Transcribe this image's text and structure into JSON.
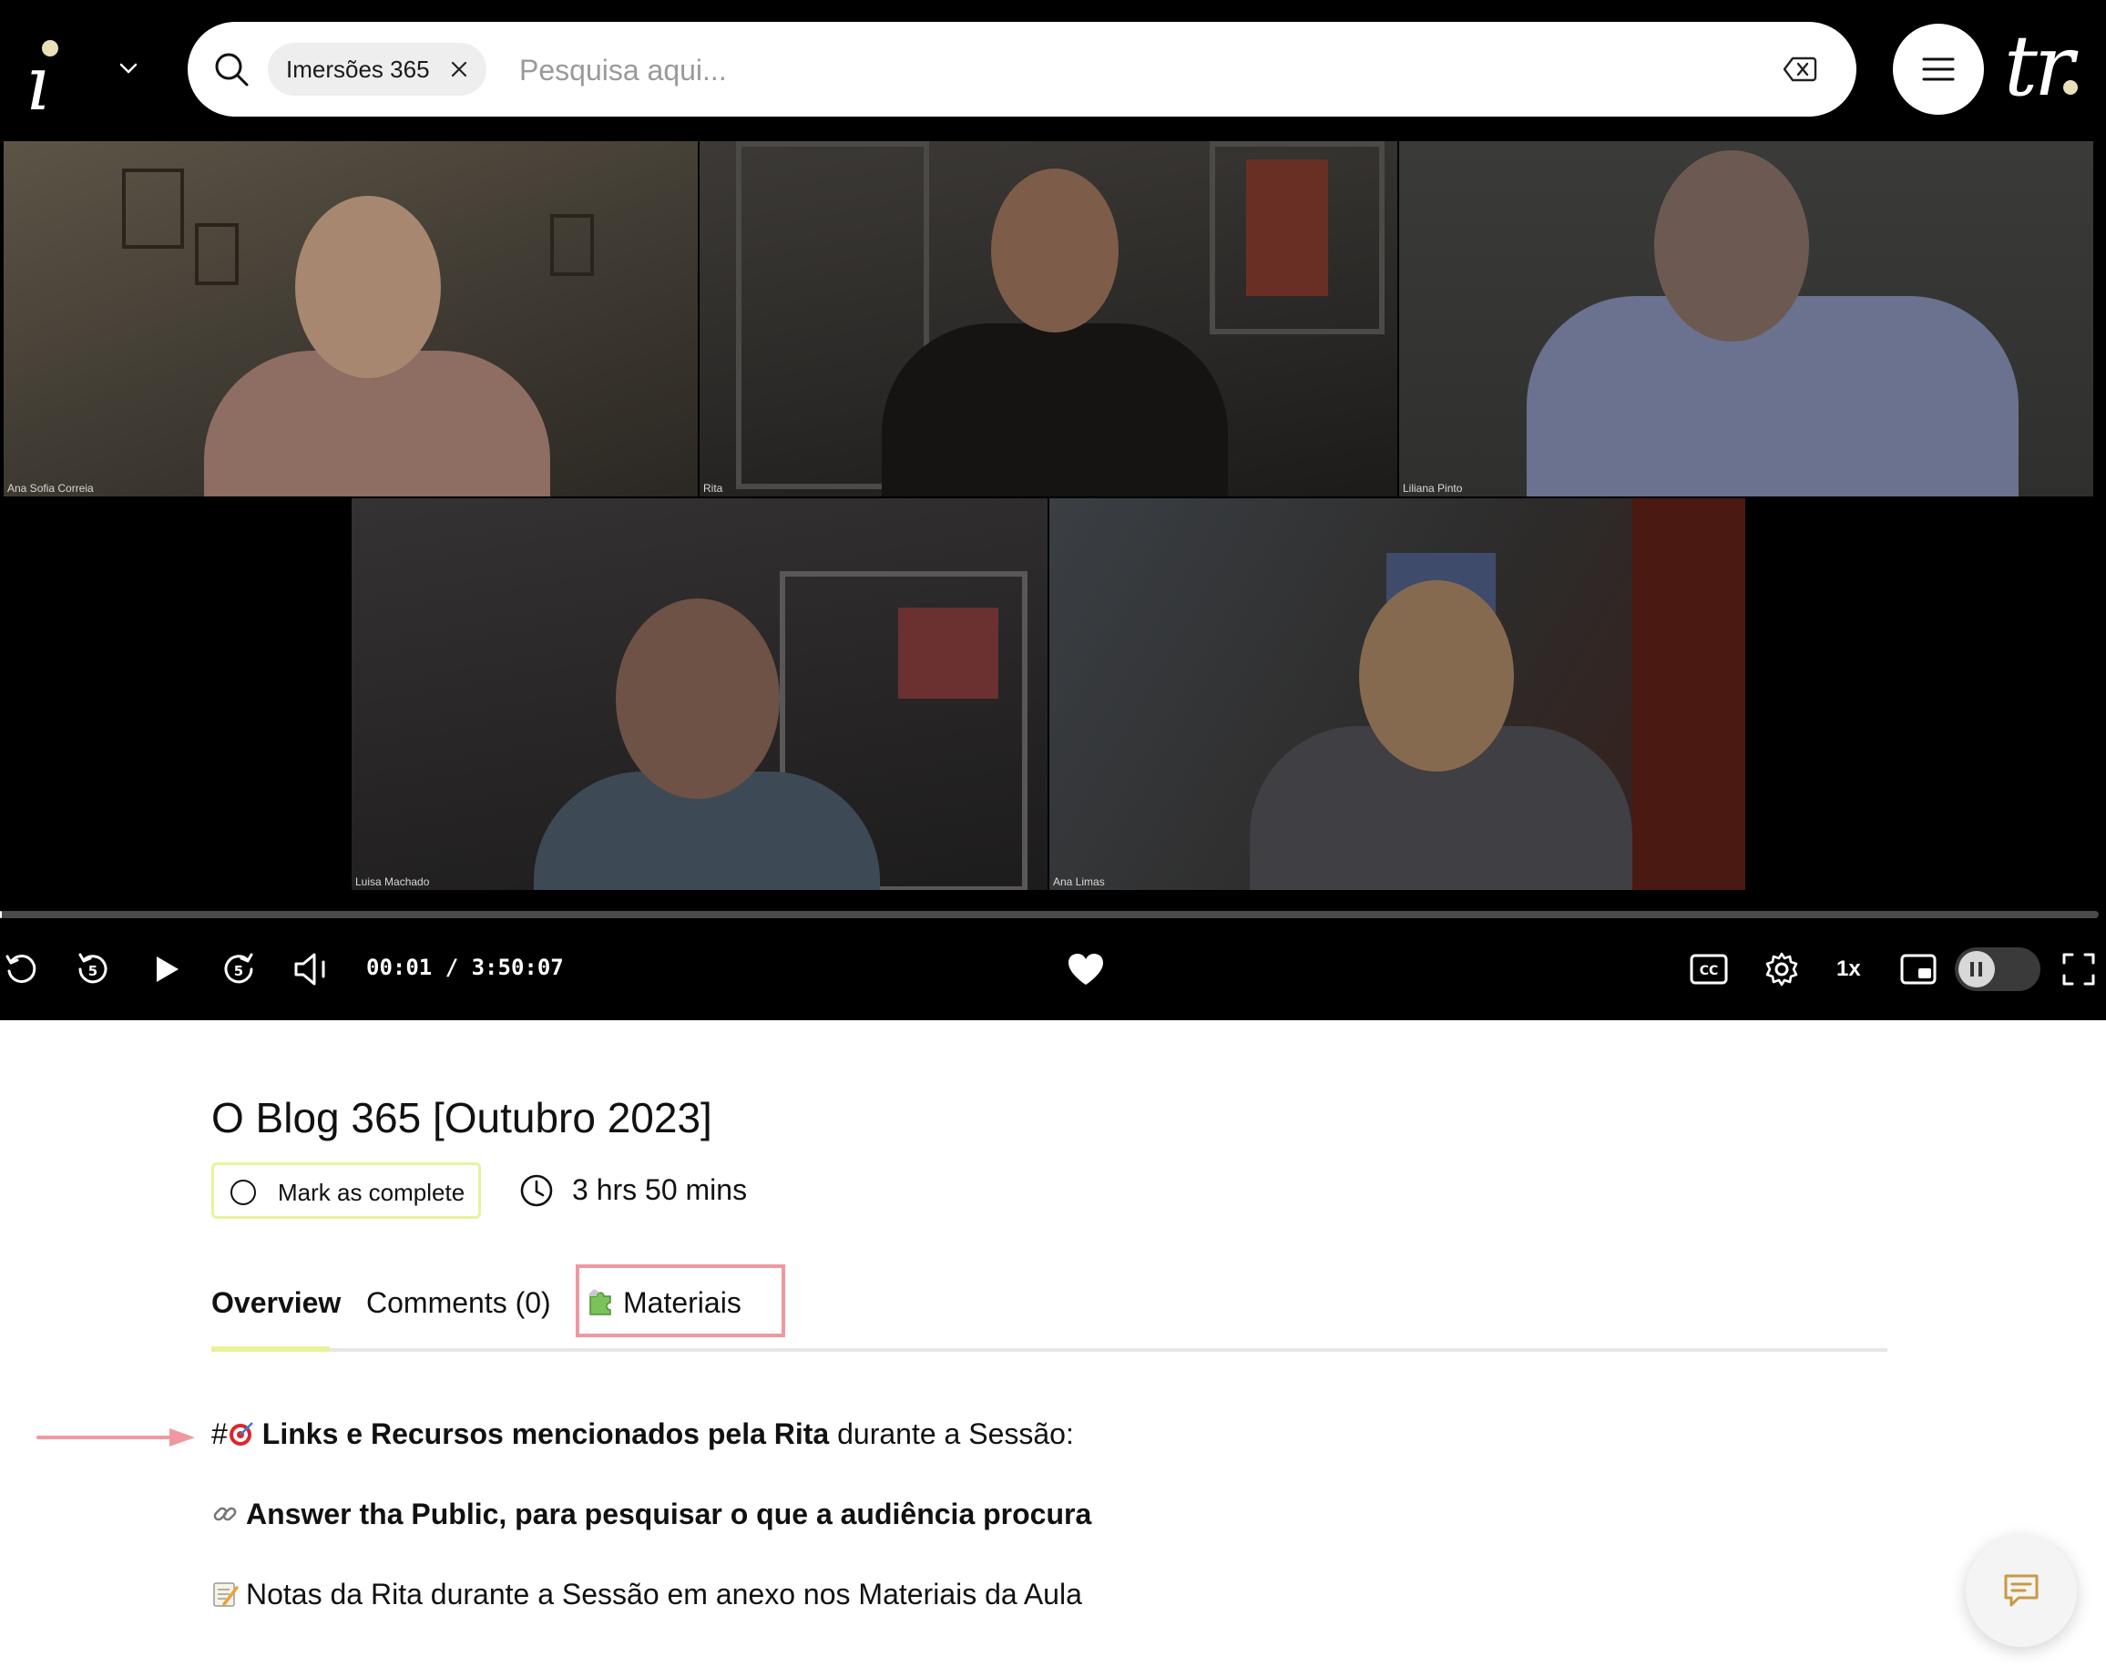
{
  "header": {
    "search_chip": "Imersões 365",
    "search_placeholder": "Pesquisa aqui..."
  },
  "video": {
    "participants": [
      "Ana Sofia Correia",
      "Rita",
      "Liliana Pinto",
      "Luisa Machado",
      "Ana Limas"
    ],
    "time": "00:01 / 3:50:07",
    "progress": 0.0001,
    "speed": "1x"
  },
  "lesson": {
    "title": "O Blog 365 [Outubro 2023]",
    "mark_complete": "Mark as complete",
    "duration": "3 hrs 50 mins"
  },
  "tabs": [
    {
      "label": "Overview",
      "active": true
    },
    {
      "label": "Comments (0)",
      "active": false
    },
    {
      "label": "Materiais",
      "active": false,
      "icon": "puzzle-icon"
    }
  ],
  "content": {
    "line1": {
      "prefix": "#",
      "bold": "Links e Recursos mencionados pela Rita",
      "rest": " durante a Sessão:"
    },
    "line2": {
      "bold": "Answer tha Public, para pesquisar o que a audiência procura"
    },
    "line3": {
      "text": "Notas da Rita durante a Sessão em anexo nos Materiais da Aula"
    }
  },
  "colors": {
    "accent_yellow": "#eaf29a",
    "highlight_pink": "#f0989f",
    "background_dark": "#000000"
  }
}
